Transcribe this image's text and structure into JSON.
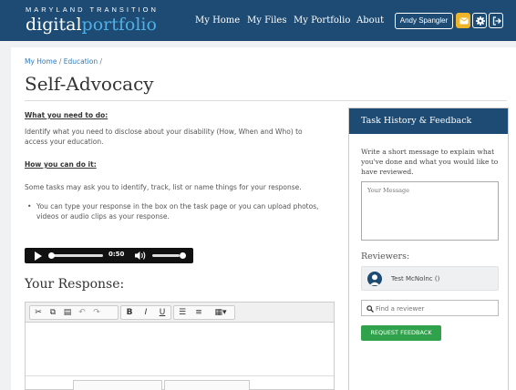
{
  "header": {
    "brand_top": "MARYLAND TRANSITION",
    "brand_main_1": "digital",
    "brand_main_2": "portfolio",
    "nav": [
      "My Home",
      "My Files",
      "My Portfolio",
      "About"
    ],
    "user_button": "Andy Spangler",
    "icons": [
      "message-icon",
      "gear-icon",
      "logout-icon"
    ],
    "colors": {
      "header_bg": "#1d4b73",
      "accent": "#4fb0e8",
      "message_btn": "#f0b428"
    }
  },
  "breadcrumb": {
    "home": "My Home",
    "separator": "/",
    "section": "Education",
    "trailing": "/"
  },
  "page": {
    "title": "Self-Advocacy",
    "section1_heading": "What you need to do:",
    "section1_text": "Identify what you need to disclose about your disability (How, When and Who) to access your education.",
    "section2_heading": "How you can do it:",
    "section2_text": "Some tasks may ask you to identify, track, list or name things for your response.",
    "bullet": "You can type your response in the box on the task page or you can upload photos, videos or audio clips as your response.",
    "audio_time": "0:50",
    "response_title": "Your Response:"
  },
  "sidebar": {
    "title": "Task History & Feedback",
    "instructions": "Write a short message to explain what you've done and what you would like to have reviewed.",
    "message_placeholder": "Your Message",
    "reviewers_label": "Reviewers:",
    "reviewer_name": "Test McNolnc ()",
    "find_placeholder": "Find a reviewer",
    "request_button": "REQUEST FEEDBACK",
    "colors": {
      "button": "#31a24c"
    }
  }
}
